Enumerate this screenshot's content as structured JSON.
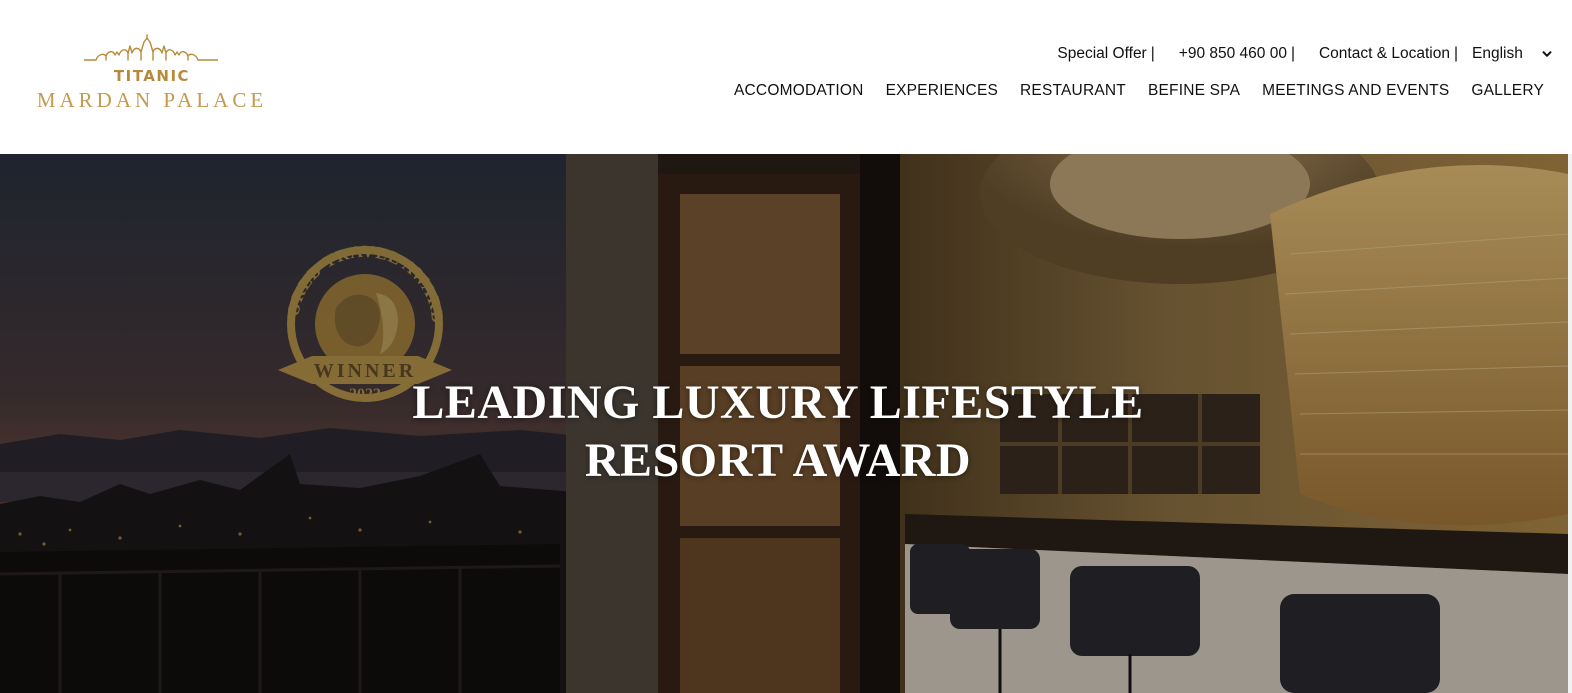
{
  "logo": {
    "brand": "TITANIC",
    "name": "MARDAN PALACE",
    "color": "#b78a3b"
  },
  "topbar": {
    "items": [
      {
        "label": "Special Offer",
        "separator": "|"
      },
      {
        "label": "+90 850 460 00",
        "separator": "|"
      },
      {
        "label": "Contact & Location",
        "separator": "|"
      }
    ],
    "language": {
      "selected": "English",
      "icon": "chevron-down-icon"
    }
  },
  "nav": {
    "items": [
      {
        "label": "ACCOMODATION"
      },
      {
        "label": "EXPERIENCES"
      },
      {
        "label": "RESTAURANT"
      },
      {
        "label": "BEFINE SPA"
      },
      {
        "label": "MEETINGS AND EVENTS"
      },
      {
        "label": "GALLERY"
      }
    ]
  },
  "hero": {
    "title_line1": "LEADING LUXURY LIFESTYLE",
    "title_line2": "RESORT AWARD",
    "badge": {
      "arc_text": "WORLD TRAVEL AWARDS",
      "ribbon_text": "WINNER",
      "year": "2023",
      "color": "#c9a43f"
    }
  }
}
